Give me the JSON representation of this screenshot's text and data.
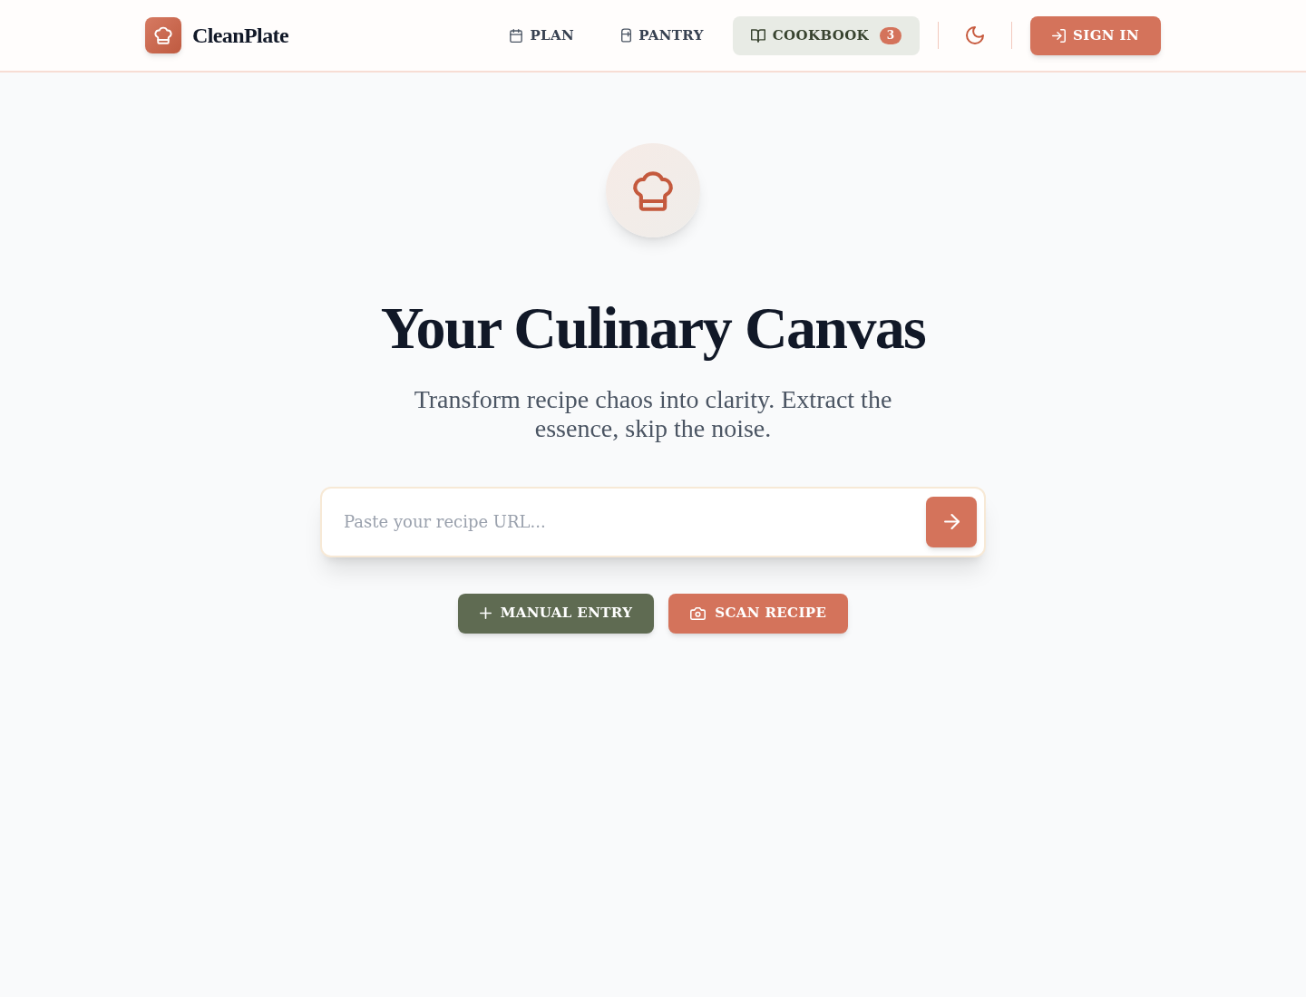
{
  "brand": {
    "name": "CleanPlate"
  },
  "nav": {
    "items": [
      {
        "label": "PLAN",
        "selected": false
      },
      {
        "label": "PANTRY",
        "selected": false
      },
      {
        "label": "COOKBOOK",
        "selected": true,
        "badge": "3"
      }
    ]
  },
  "sign_in": {
    "label": "SIGN IN"
  },
  "hero": {
    "title": "Your Culinary Canvas",
    "subtitle": "Transform recipe chaos into clarity. Extract the essence, skip the noise."
  },
  "url_form": {
    "placeholder": "Paste your recipe URL..."
  },
  "actions": [
    {
      "label": "MANUAL ENTRY",
      "kind": "secondary"
    },
    {
      "label": "SCAN RECIPE",
      "kind": "primary"
    }
  ]
}
